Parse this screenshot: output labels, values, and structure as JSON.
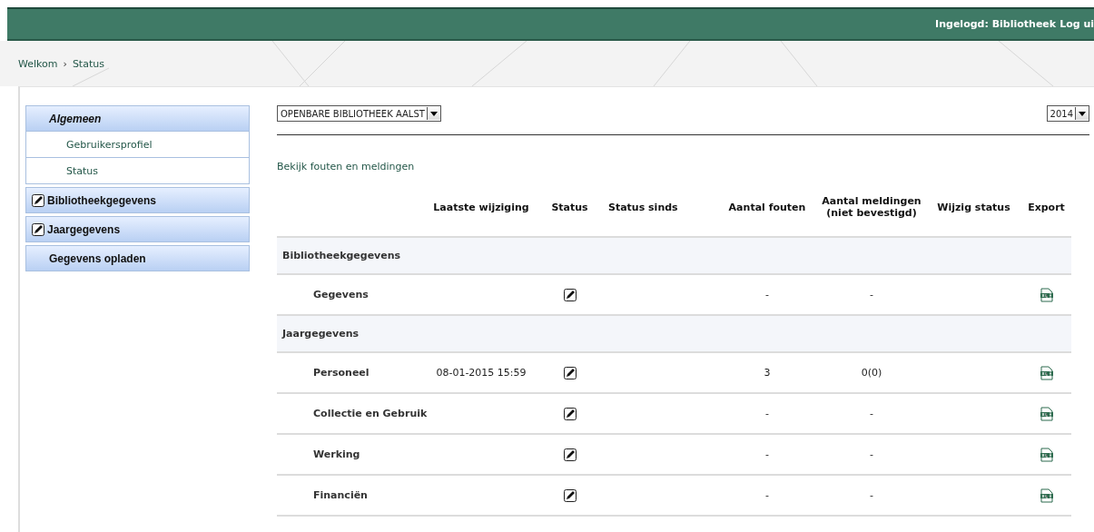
{
  "top_bar": {
    "user_text": "Ingelogd: Bibliotheek",
    "logout": "Log ui"
  },
  "breadcrumb": [
    {
      "label": "Welkom"
    },
    {
      "label": "Status"
    }
  ],
  "breadcrumb_separator": "›",
  "sidebar": {
    "items": [
      {
        "kind": "group",
        "label": "Algemeen",
        "editable": false,
        "italic": true,
        "children": [
          {
            "label": "Gebruikersprofiel"
          },
          {
            "label": "Status"
          }
        ]
      },
      {
        "kind": "group",
        "label": "Bibliotheekgegevens",
        "editable": true,
        "italic": false
      },
      {
        "kind": "group",
        "label": "Jaargegevens",
        "editable": true,
        "italic": false
      },
      {
        "kind": "group",
        "label": "Gegevens opladen",
        "editable": false,
        "italic": false
      }
    ]
  },
  "library_select": {
    "value": "OPENBARE BIBLIOTHEEK AALST"
  },
  "year_select": {
    "value": "2014"
  },
  "link": "Bekijk fouten en meldingen",
  "table": {
    "columns": [
      "",
      "Laatste wijziging",
      "Status",
      "Status sinds",
      "Aantal fouten",
      "Aantal meldingen (niet bevestigd)",
      "Wijzig status",
      "Export"
    ],
    "rows": [
      {
        "kind": "section",
        "name": "Bibliotheekgegevens"
      },
      {
        "kind": "item",
        "name": "Gegevens",
        "last_change": "",
        "errors": "-",
        "messages": "-"
      },
      {
        "kind": "section",
        "name": "Jaargegevens"
      },
      {
        "kind": "item",
        "name": "Personeel",
        "last_change": "08-01-2015 15:59",
        "errors": "3",
        "messages": "0(0)"
      },
      {
        "kind": "item",
        "name": "Collectie en Gebruik",
        "last_change": "",
        "errors": "-",
        "messages": "-"
      },
      {
        "kind": "item",
        "name": "Werking",
        "last_change": "",
        "errors": "-",
        "messages": "-"
      },
      {
        "kind": "item",
        "name": "Financiën",
        "last_change": "",
        "errors": "-",
        "messages": "-"
      }
    ]
  }
}
